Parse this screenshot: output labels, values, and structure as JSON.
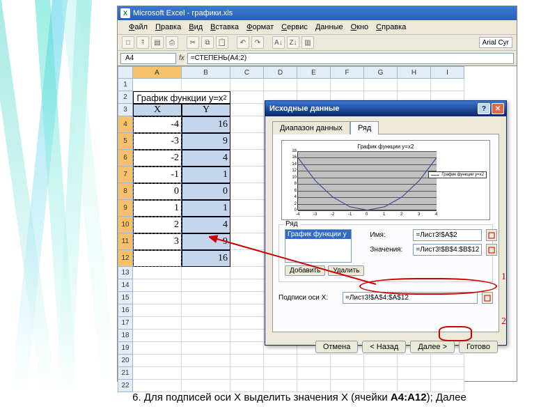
{
  "app": {
    "title": "Microsoft Excel - графики.xls"
  },
  "menu": [
    "Файл",
    "Правка",
    "Вид",
    "Вставка",
    "Формат",
    "Сервис",
    "Данные",
    "Окно",
    "Справка"
  ],
  "toolbar_font": "Arial Cyr",
  "namebox": "A4",
  "formula": "=СТЕПЕНЬ(A4;2)",
  "columns": [
    "A",
    "B",
    "C",
    "D",
    "E",
    "F",
    "G",
    "H",
    "I"
  ],
  "row_numbers": [
    1,
    2,
    3,
    4,
    5,
    6,
    7,
    8,
    9,
    10,
    11,
    12,
    13,
    14,
    15,
    16,
    17,
    18,
    19,
    20,
    21,
    22
  ],
  "sheet": {
    "title": "График  функции y=x",
    "title_sup": "2",
    "hx": "X",
    "hy": "Y",
    "rows": [
      {
        "x": "-4",
        "y": "16"
      },
      {
        "x": "-3",
        "y": "9"
      },
      {
        "x": "-2",
        "y": "4"
      },
      {
        "x": "-1",
        "y": "1"
      },
      {
        "x": "0",
        "y": "0"
      },
      {
        "x": "1",
        "y": "1"
      },
      {
        "x": "2",
        "y": "4"
      },
      {
        "x": "3",
        "y": "9"
      },
      {
        "x": "",
        "y": "16"
      }
    ]
  },
  "dialog": {
    "title": "Исходные данные",
    "tab1": "Диапазон данных",
    "tab2": "Ряд",
    "chart_title": "График  функции y=x2",
    "legend": "График  функции y=x2",
    "ryad_label": "Ряд",
    "series_item": "График  функции y",
    "add": "Добавить",
    "del": "Удалить",
    "name_lbl": "Имя:",
    "name_val": "=Лист3!$A$2",
    "val_lbl": "Значения:",
    "val_val": "=Лист3!$B$4:$B$12",
    "xaxis_lbl": "Подписи оси X:",
    "xaxis_val": "=Лист3!$A$4:$A$12",
    "btn_cancel": "Отмена",
    "btn_back": "< Назад",
    "btn_next": "Далее >",
    "btn_finish": "Готово"
  },
  "annot": {
    "n1": "1",
    "n2": "2"
  },
  "caption_pre": "6. Для подписей оси Х выделить значения Х (ячейки ",
  "caption_bold": "А4:А12",
  "caption_post": "); Далее",
  "chart_data": {
    "type": "line",
    "title": "График  функции y=x2",
    "x": [
      -4,
      -3,
      -2,
      -1,
      0,
      1,
      2,
      3,
      4
    ],
    "series": [
      {
        "name": "График  функции y=x2",
        "values": [
          16,
          9,
          4,
          1,
          0,
          1,
          4,
          9,
          16
        ]
      }
    ],
    "ylim": [
      0,
      18
    ],
    "yticks": [
      0,
      2,
      4,
      6,
      8,
      10,
      12,
      14,
      16,
      18
    ],
    "xticks": [
      -4,
      -3,
      -2,
      -1,
      0,
      1,
      2,
      3,
      4
    ]
  }
}
